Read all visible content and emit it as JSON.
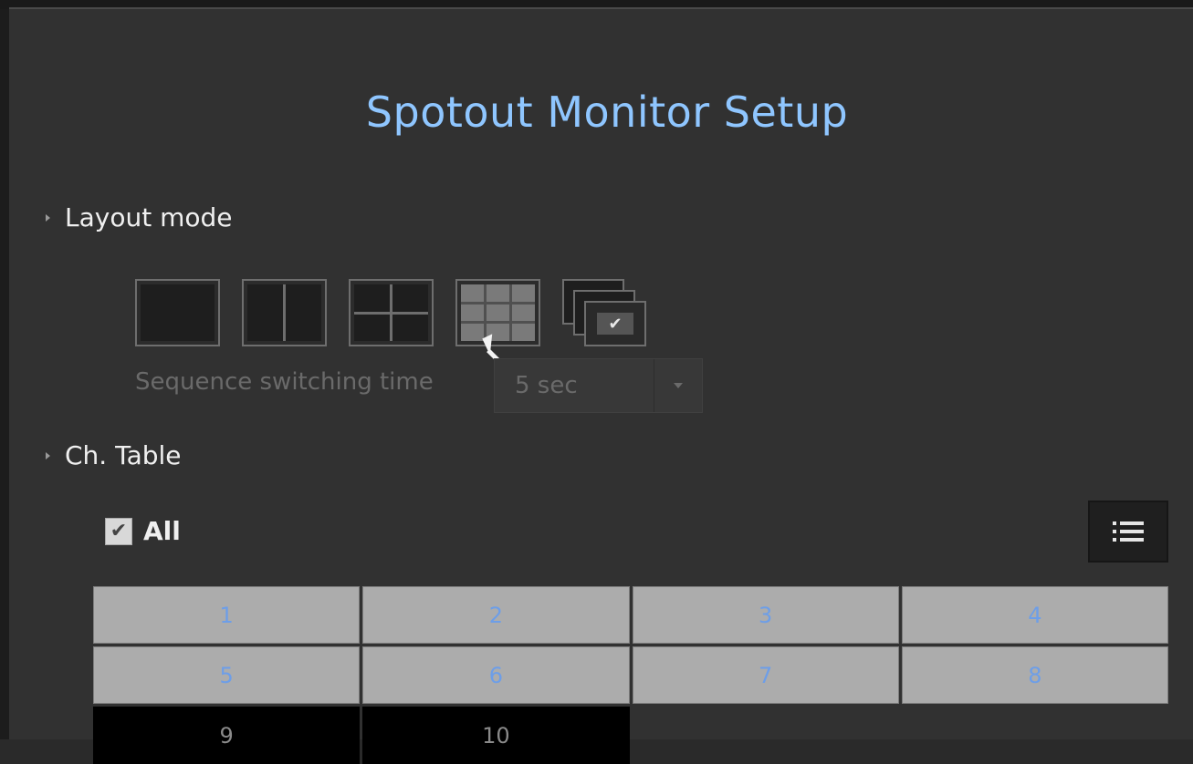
{
  "title": "Spotout Monitor Setup",
  "layout_section": {
    "label": "Layout mode",
    "buttons": [
      {
        "name": "layout-1-button",
        "icon": "single-screen-icon"
      },
      {
        "name": "layout-2-button",
        "icon": "split-2-icon"
      },
      {
        "name": "layout-4-button",
        "icon": "split-4-icon"
      },
      {
        "name": "layout-9-button",
        "icon": "split-9-icon",
        "selected": true
      },
      {
        "name": "sequence-button",
        "icon": "sequence-check-icon"
      }
    ],
    "sequence_label": "Sequence switching time",
    "sequence_value": "5 sec"
  },
  "ch_table_section": {
    "label": "Ch. Table",
    "all_label": "All",
    "all_checked": true,
    "list_button_icon": "list-icon",
    "channels": [
      "1",
      "2",
      "3",
      "4",
      "5",
      "6",
      "7",
      "8",
      "9",
      "10"
    ]
  },
  "colors": {
    "title": "#8fc6ff",
    "channel_text": "#6d9ee8",
    "background": "#313131"
  }
}
